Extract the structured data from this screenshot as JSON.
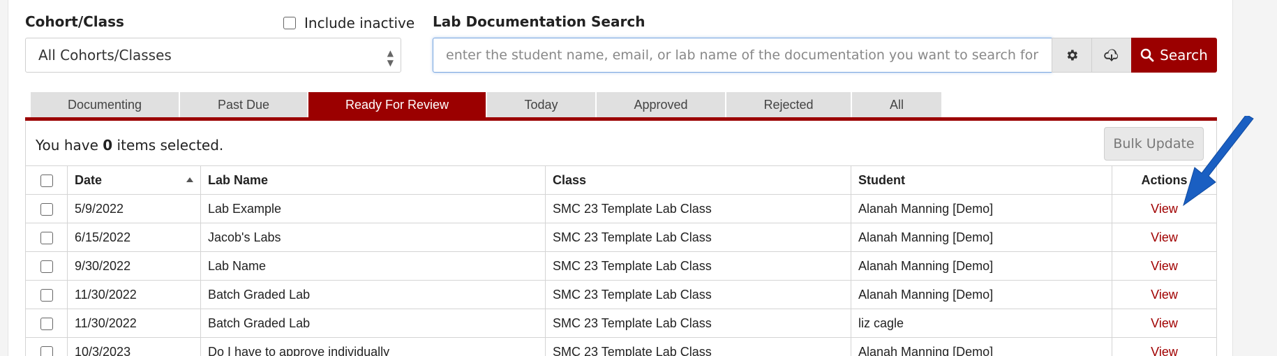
{
  "filters": {
    "cohort_label": "Cohort/Class",
    "include_inactive_label": "Include inactive",
    "cohort_value": "All Cohorts/Classes"
  },
  "search": {
    "label": "Lab Documentation Search",
    "placeholder": "enter the student name, email, or lab name of the documentation you want to search for",
    "button_label": "Search"
  },
  "tabs": [
    {
      "label": "Documenting"
    },
    {
      "label": "Past Due"
    },
    {
      "label": "Ready For Review",
      "active": true
    },
    {
      "label": "Today"
    },
    {
      "label": "Approved"
    },
    {
      "label": "Rejected"
    },
    {
      "label": "All"
    }
  ],
  "selection": {
    "prefix": "You have",
    "count": "0",
    "suffix": "items selected."
  },
  "bulk_update_label": "Bulk Update",
  "table": {
    "headers": {
      "date": "Date",
      "lab_name": "Lab Name",
      "class": "Class",
      "student": "Student",
      "actions": "Actions"
    },
    "rows": [
      {
        "date": "5/9/2022",
        "lab_name": "Lab Example",
        "class": "SMC 23 Template Lab Class",
        "student": "Alanah Manning [Demo]",
        "action": "View"
      },
      {
        "date": "6/15/2022",
        "lab_name": "Jacob's Labs",
        "class": "SMC 23 Template Lab Class",
        "student": "Alanah Manning [Demo]",
        "action": "View"
      },
      {
        "date": "9/30/2022",
        "lab_name": "Lab Name",
        "class": "SMC 23 Template Lab Class",
        "student": "Alanah Manning [Demo]",
        "action": "View"
      },
      {
        "date": "11/30/2022",
        "lab_name": "Batch Graded Lab",
        "class": "SMC 23 Template Lab Class",
        "student": "Alanah Manning [Demo]",
        "action": "View"
      },
      {
        "date": "11/30/2022",
        "lab_name": "Batch Graded Lab",
        "class": "SMC 23 Template Lab Class",
        "student": "liz cagle",
        "action": "View"
      },
      {
        "date": "10/3/2023",
        "lab_name": "Do I have to approve individually",
        "class": "SMC 23 Template Lab Class",
        "student": "Alanah Manning [Demo]",
        "action": "View"
      }
    ]
  },
  "colors": {
    "accent": "#9b0000",
    "link": "#a00000",
    "arrow": "#1a5fc2"
  }
}
